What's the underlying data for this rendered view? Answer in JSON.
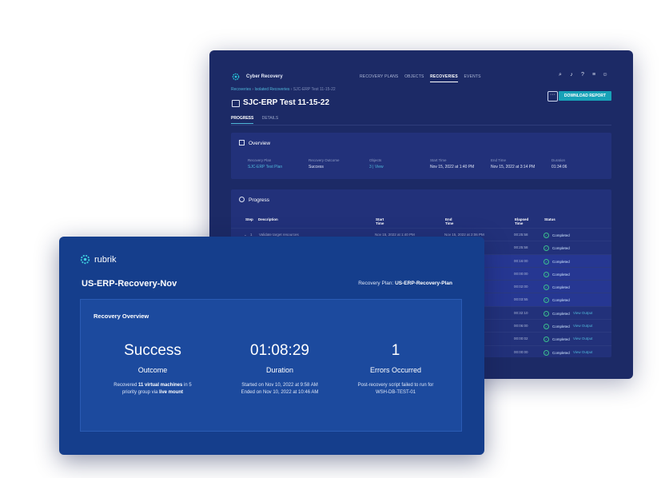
{
  "back": {
    "app_name": "Cyber Recovery",
    "nav": [
      "RECOVERY PLANS",
      "OBJECTS",
      "RECOVERIES",
      "EVENTS"
    ],
    "nav_active": "RECOVERIES",
    "icons": [
      "search-icon",
      "bell-icon",
      "help-icon",
      "menu-icon",
      "user-icon"
    ],
    "breadcrumb": {
      "a": "Recoveries",
      "b": "Isolated Recoveries",
      "c": "SJC-ERP Test 11-15-22"
    },
    "title": "SJC-ERP Test 11-15-22",
    "more_label": "···",
    "download_label": "DOWNLOAD REPORT",
    "tabs": [
      "PROGRESS",
      "DETAILS"
    ],
    "overview": {
      "title": "Overview",
      "fields": [
        {
          "k": "Recovery Plan",
          "v": "SJC-ERP Test Plan"
        },
        {
          "k": "Recovery Outcome",
          "v": "Success"
        },
        {
          "k": "Objects",
          "v": "3 | View"
        },
        {
          "k": "Start Time",
          "v": "Nov 15, 2022 at 1:40 PM"
        },
        {
          "k": "End Time",
          "v": "Nov 15, 2022 at 3:14 PM"
        },
        {
          "k": "Duration",
          "v": "01:34:06"
        }
      ]
    },
    "progress": {
      "title": "Progress",
      "headers": [
        "Step",
        "Description",
        "Start Time",
        "End Time",
        "Elapsed Time",
        "Status"
      ],
      "rows": [
        {
          "step": "1",
          "desc": "Validate target resources",
          "start": "Nov 15, 2022 at 1:40 PM",
          "end": "Nov 15, 2022 at 2:06 PM",
          "elapsed": "00:25:58",
          "status": "Completed",
          "link": ""
        },
        {
          "step": "",
          "desc": "",
          "start": "",
          "end": "",
          "elapsed": "00:25:58",
          "status": "Completed",
          "link": ""
        },
        {
          "step": "",
          "desc": "",
          "start": "",
          "end": "",
          "elapsed": "00:16:00",
          "status": "Completed",
          "link": ""
        },
        {
          "step": "",
          "desc": "",
          "start": "",
          "end": "",
          "elapsed": "00:00:00",
          "status": "Completed",
          "link": ""
        },
        {
          "step": "",
          "desc": "",
          "start": "",
          "end": "",
          "elapsed": "00:02:00",
          "status": "Completed",
          "link": ""
        },
        {
          "step": "",
          "desc": "",
          "start": "",
          "end": "",
          "elapsed": "00:03:55",
          "status": "Completed",
          "link": ""
        },
        {
          "step": "",
          "desc": "",
          "start": "",
          "end": "",
          "elapsed": "00:32:10",
          "status": "Completed",
          "link": "View Output"
        },
        {
          "step": "",
          "desc": "",
          "start": "",
          "end": "",
          "elapsed": "00:06:00",
          "status": "Completed",
          "link": "View Output"
        },
        {
          "step": "",
          "desc": "",
          "start": "",
          "end": "",
          "elapsed": "00:00:02",
          "status": "Completed",
          "link": "View Output"
        },
        {
          "step": "",
          "desc": "",
          "start": "",
          "end": "",
          "elapsed": "00:00:00",
          "status": "Completed",
          "link": "View Output"
        }
      ]
    }
  },
  "front": {
    "brand": "rubrik",
    "title": "US-ERP-Recovery-Nov",
    "plan_label": "Recovery Plan:",
    "plan_value": "US-ERP-Recovery-Plan",
    "card_title": "Recovery Overview",
    "metrics": {
      "outcome": {
        "big": "Success",
        "label": "Outcome"
      },
      "duration": {
        "big": "01:08:29",
        "label": "Duration",
        "line1": "Started on Nov 10, 2022 at 9:58 AM",
        "line2": "Ended on Nov 10, 2022 at 10:46 AM"
      },
      "errors": {
        "big": "1",
        "label": "Errors Occurred",
        "line1": "Post-recovery script failed to run for",
        "line2": "WSH-DB-TEST-01"
      }
    },
    "outcome_desc": {
      "p1": "Recovered ",
      "b1": "11 virtual machines",
      "p2": " in 5",
      "p3": "priority group via ",
      "b2": "live mount"
    }
  },
  "colors": {
    "accent": "#17a2b8",
    "back_bg": "#1c2a66",
    "front_bg": "#153e8c",
    "success": "#3cc08e"
  }
}
